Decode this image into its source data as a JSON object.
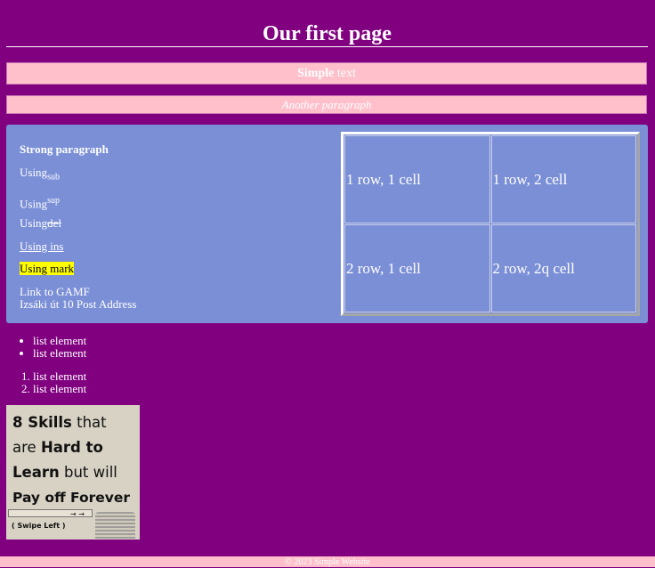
{
  "header": {
    "title": "Our first page"
  },
  "para1": {
    "bold": "Simple",
    "rest": " text"
  },
  "para2": {
    "text": "Another paragraph"
  },
  "section": {
    "strong": "Strong paragraph",
    "sub": {
      "text": "Using",
      "sub": "sub"
    },
    "sup": {
      "text": "Using",
      "sup": "sup"
    },
    "del": {
      "text": "Using",
      "del": "del"
    },
    "ins": "Using ins",
    "mark": "Using mark",
    "link": "Link to GAMF",
    "address": "Izsáki út 10 Post Address"
  },
  "table": {
    "rows": [
      [
        "1 row, 1 cell",
        "1 row, 2 cell"
      ],
      [
        "2 row, 1 cell",
        "2 row, 2q cell"
      ]
    ]
  },
  "unordered_list": [
    "list element",
    "list element"
  ],
  "ordered_list": [
    "list element",
    "list element"
  ],
  "image": {
    "lines": [
      [
        "8 Skills",
        " that"
      ],
      [
        "are ",
        "Hard to"
      ],
      [
        "Learn",
        " but will"
      ],
      [
        "Pay off Forever",
        ""
      ]
    ],
    "caption": "( Swipe Left )"
  },
  "footer": {
    "text": "© 2023 Simple Website"
  }
}
